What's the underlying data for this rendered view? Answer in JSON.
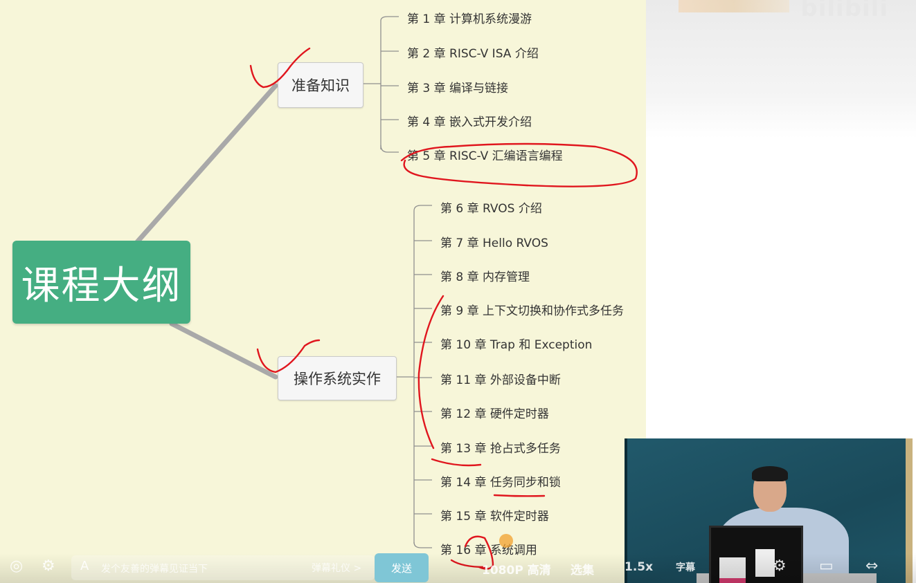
{
  "mindmap": {
    "root": "课程大纲",
    "branches": [
      {
        "label": "准备知识",
        "chapters": [
          "第 1 章 计算机系统漫游",
          "第 2 章 RISC-V ISA 介绍",
          "第 3 章 编译与链接",
          "第 4 章 嵌入式开发介绍",
          "第 5 章 RISC-V 汇编语言编程"
        ]
      },
      {
        "label": "操作系统实作",
        "chapters": [
          "第 6 章 RVOS 介绍",
          "第 7 章 Hello RVOS",
          "第 8 章 内存管理",
          "第 9 章 上下文切换和协作式多任务",
          "第 10 章 Trap 和 Exception",
          "第 11 章 外部设备中断",
          "第 12 章 硬件定时器",
          "第 13 章 抢占式多任务",
          "第 14 章 任务同步和锁",
          "第 15 章 软件定时器",
          "第 16 章 系统调用"
        ]
      }
    ]
  },
  "watermark": "bilibili",
  "player_controls": {
    "danmaku_input_prefix": "A",
    "danmaku_placeholder": "发个友善的弹幕见证当下",
    "etiquette_link": "弹幕礼仪 >",
    "send_label": "发送",
    "quality": "1080P 高清",
    "episodes": "选集",
    "speed": "1.5x",
    "subtitle_label": "字幕"
  },
  "colors": {
    "slide_bg": "#f7f6d9",
    "root_bg": "#45ae82",
    "annotation": "#e0161e",
    "send_button": "#7fc6d6"
  }
}
